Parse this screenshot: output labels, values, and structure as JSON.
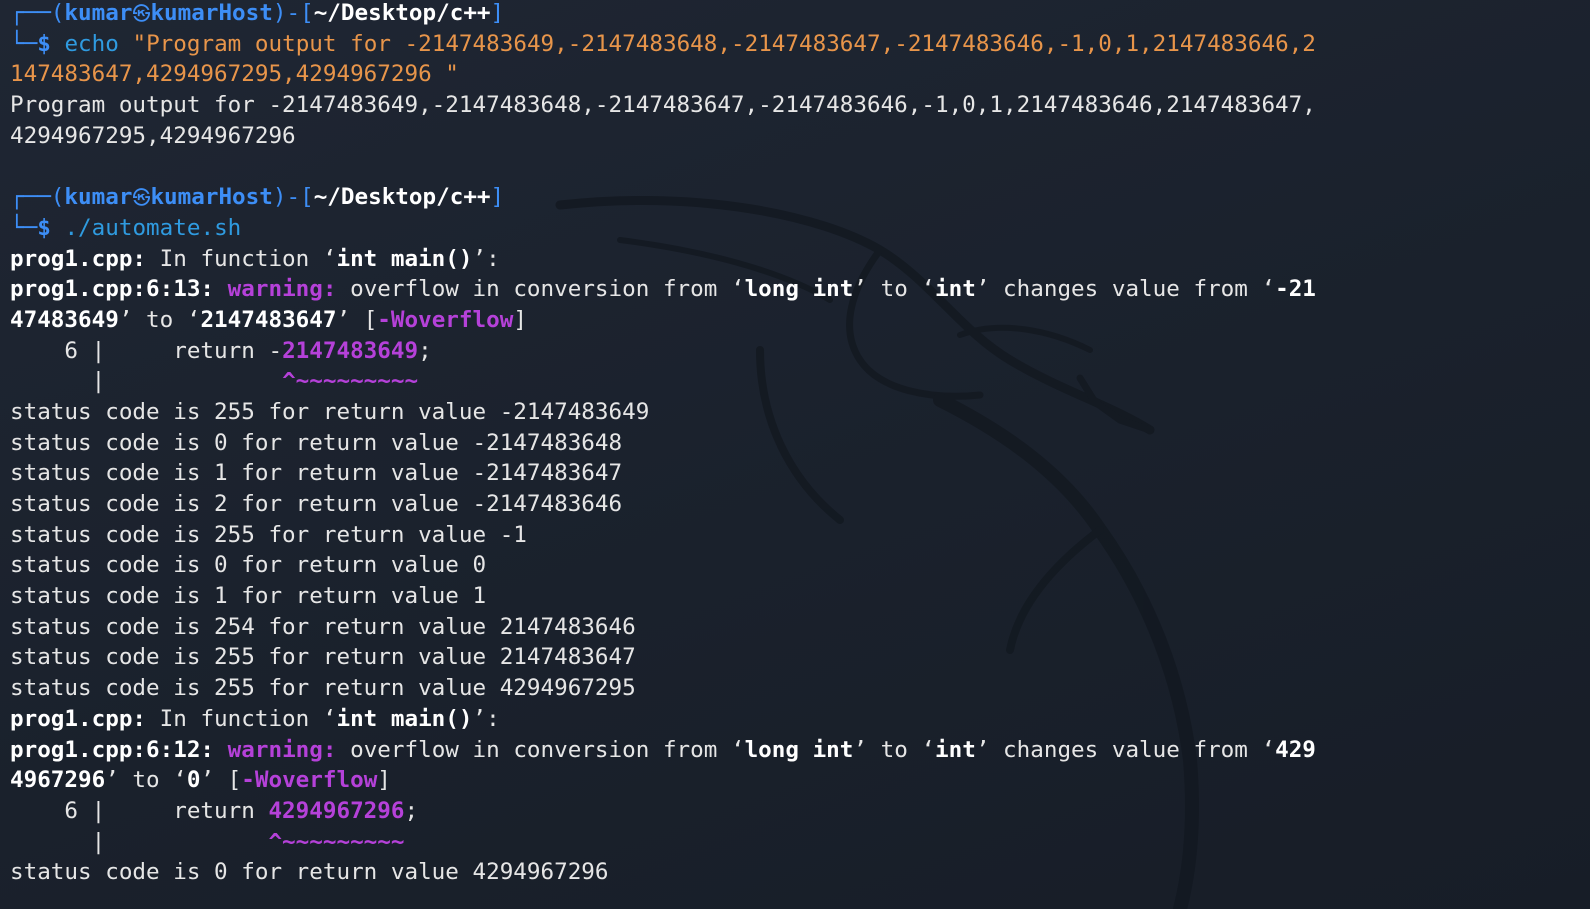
{
  "prompt": {
    "box_top": "┌──(",
    "user": "kumar",
    "at_icon": "㉿",
    "host": "kumarHost",
    "sep_open": ")-[",
    "path": "~/Desktop/c++",
    "sep_close": "]",
    "box_bottom": "└─",
    "dollar": "$"
  },
  "commands": {
    "echo_cmd": "echo",
    "echo_arg_1": "\"Program output for -2147483649,-2147483648,-2147483647,-2147483646,-1,0,1,2147483646,2",
    "echo_arg_2": "147483647,4294967295,4294967296 \"",
    "automate_cmd": "./automate.sh"
  },
  "echo_output": {
    "line1": "Program output for -2147483649,-2147483648,-2147483647,-2147483646,-1,0,1,2147483646,2147483647,",
    "line2": "4294967295,4294967296"
  },
  "diag1": {
    "file": "prog1.cpp:",
    "in_function": " In function ‘",
    "func": "int main()",
    "func_end": "’:",
    "loc": "prog1.cpp:6:13:",
    "warning": "warning:",
    "msg_a": " overflow in conversion from ‘",
    "from_type": "long int",
    "msg_b": "’ to ‘",
    "to_type": "int",
    "msg_c": "’ changes value from ‘",
    "from_val_1": "-21",
    "from_val_2": "47483649",
    "msg_d": "’ to ‘",
    "to_val": "2147483647",
    "msg_e": "’ [",
    "flag": "-Woverflow",
    "msg_f": "]",
    "code_prefix": "    6 |     return -",
    "code_value": "2147483649",
    "code_suffix": ";",
    "caret_prefix": "      |             ",
    "caret": "^~~~~~~~~~"
  },
  "status_lines": [
    "status code is 255 for return value -2147483649",
    "status code is 0 for return value -2147483648",
    "status code is 1 for return value -2147483647",
    "status code is 2 for return value -2147483646",
    "status code is 255 for return value -1",
    "status code is 0 for return value 0",
    "status code is 1 for return value 1",
    "status code is 254 for return value 2147483646",
    "status code is 255 for return value 2147483647",
    "status code is 255 for return value 4294967295"
  ],
  "diag2": {
    "file": "prog1.cpp:",
    "in_function": " In function ‘",
    "func": "int main()",
    "func_end": "’:",
    "loc": "prog1.cpp:6:12:",
    "warning": "warning:",
    "msg_a": " overflow in conversion from ‘",
    "from_type": "long int",
    "msg_b": "’ to ‘",
    "to_type": "int",
    "msg_c": "’ changes value from ‘",
    "from_val_1": "429",
    "from_val_2": "4967296",
    "msg_d": "’ to ‘",
    "to_val": "0",
    "msg_e": "’ [",
    "flag": "-Woverflow",
    "msg_f": "]",
    "code_prefix": "    6 |     return ",
    "code_value": "4294967296",
    "code_suffix": ";",
    "caret_prefix": "      |            ",
    "caret": "^~~~~~~~~~"
  },
  "final_status": "status code is 0 for return value 4294967296",
  "colors": {
    "background": "#1b222d",
    "prompt_blue": "#3d8ef6",
    "command_blue": "#2f9be0",
    "string_orange": "#e8954a",
    "warning_purple": "#b541d9",
    "text": "#e6e6e6"
  }
}
